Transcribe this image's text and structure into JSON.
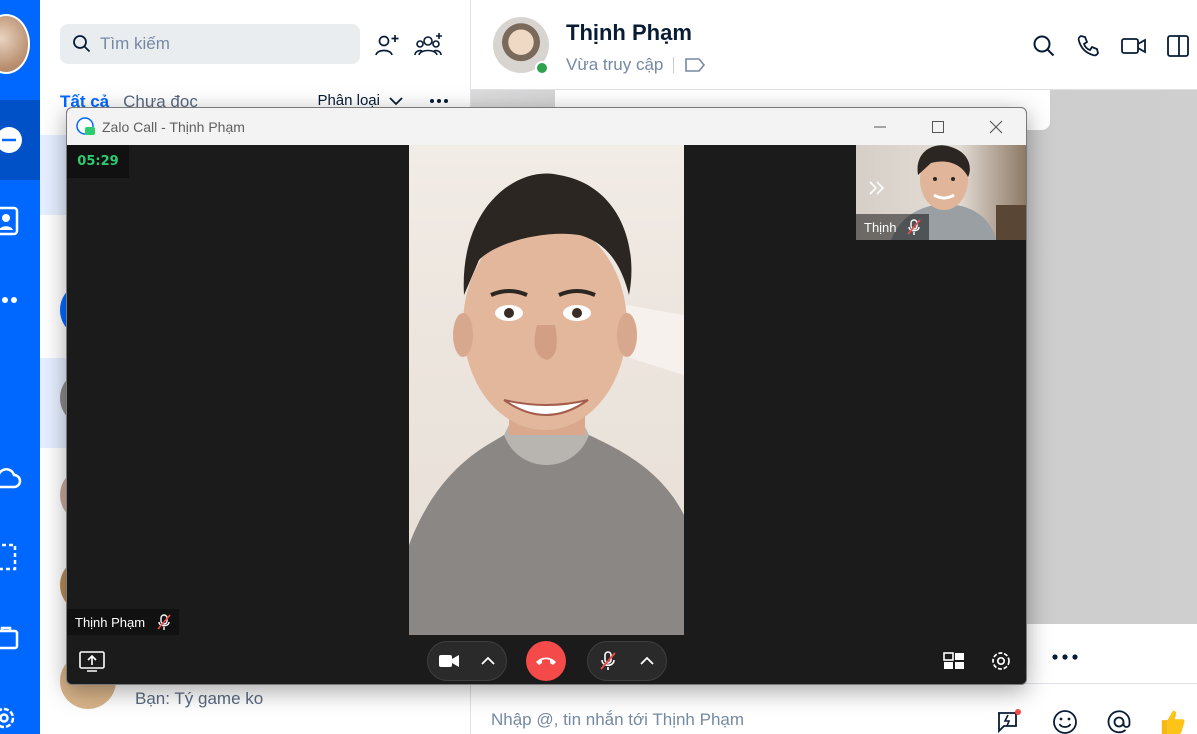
{
  "colors": {
    "brand_blue": "#0068ff",
    "online_green": "#30a14e",
    "hangup_red": "#f44a4a",
    "timer_green": "#2ecc71",
    "call_bg": "#1b1b1b"
  },
  "sidebar": {
    "items": [
      {
        "icon": "chat-icon",
        "active": true
      },
      {
        "icon": "contacts-icon",
        "active": false
      },
      {
        "icon": "more-dots-icon",
        "active": false
      },
      {
        "icon": "cloud-icon",
        "active": false
      },
      {
        "icon": "screenshot-icon",
        "active": false
      },
      {
        "icon": "toolbox-icon",
        "active": false
      },
      {
        "icon": "settings-icon",
        "active": false
      }
    ]
  },
  "list": {
    "search_placeholder": "Tìm kiếm",
    "tabs": [
      {
        "label": "Tất cả",
        "active": true
      },
      {
        "label": "Chưa đọc",
        "active": false
      }
    ],
    "classify_label": "Phân loại",
    "last_message": "Bạn: Tý game ko"
  },
  "chat": {
    "contact_name": "Thịnh Phạm",
    "status": "Vừa truy cập",
    "composer_placeholder": "Nhập @, tin nhắn tới Thịnh Phạm"
  },
  "call": {
    "window_title": "Zalo Call - Thịnh Phạm",
    "timer": "05:29",
    "remote_name": "Thịnh Phạm",
    "self_name": "Thịnh"
  }
}
